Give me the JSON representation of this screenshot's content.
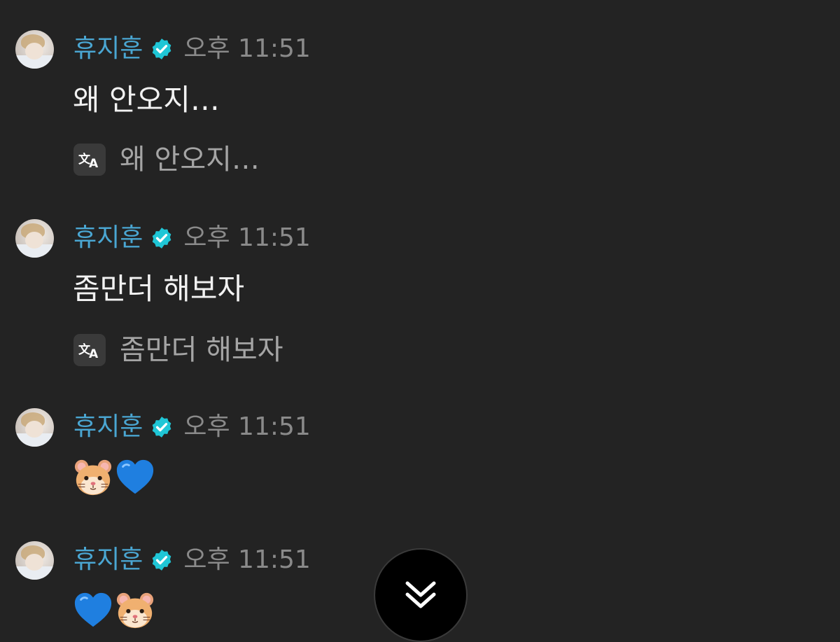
{
  "messages": [
    {
      "author": "휴지훈",
      "time": "오후 11:51",
      "text": "왜 안오지…",
      "translation": "왜 안오지…"
    },
    {
      "author": "휴지훈",
      "time": "오후 11:51",
      "text": "좀만더 해보자",
      "translation": "좀만더 해보자"
    },
    {
      "author": "휴지훈",
      "time": "오후 11:51",
      "emojis": [
        "hamster-face",
        "blue-heart"
      ]
    },
    {
      "author": "휴지훈",
      "time": "오후 11:51",
      "emojis": [
        "blue-heart",
        "hamster-face"
      ]
    }
  ],
  "icons": {
    "verified": "verified-badge-icon",
    "translate": "translate-icon",
    "scroll_down": "double-chevron-down-icon"
  },
  "colors": {
    "background": "#232323",
    "author_name": "#4aa6d2",
    "verified_badge": "#1fc6d6",
    "timestamp": "#8a8a8a",
    "message_text": "#f2f2f2",
    "translation_text": "#a5a5a5"
  }
}
